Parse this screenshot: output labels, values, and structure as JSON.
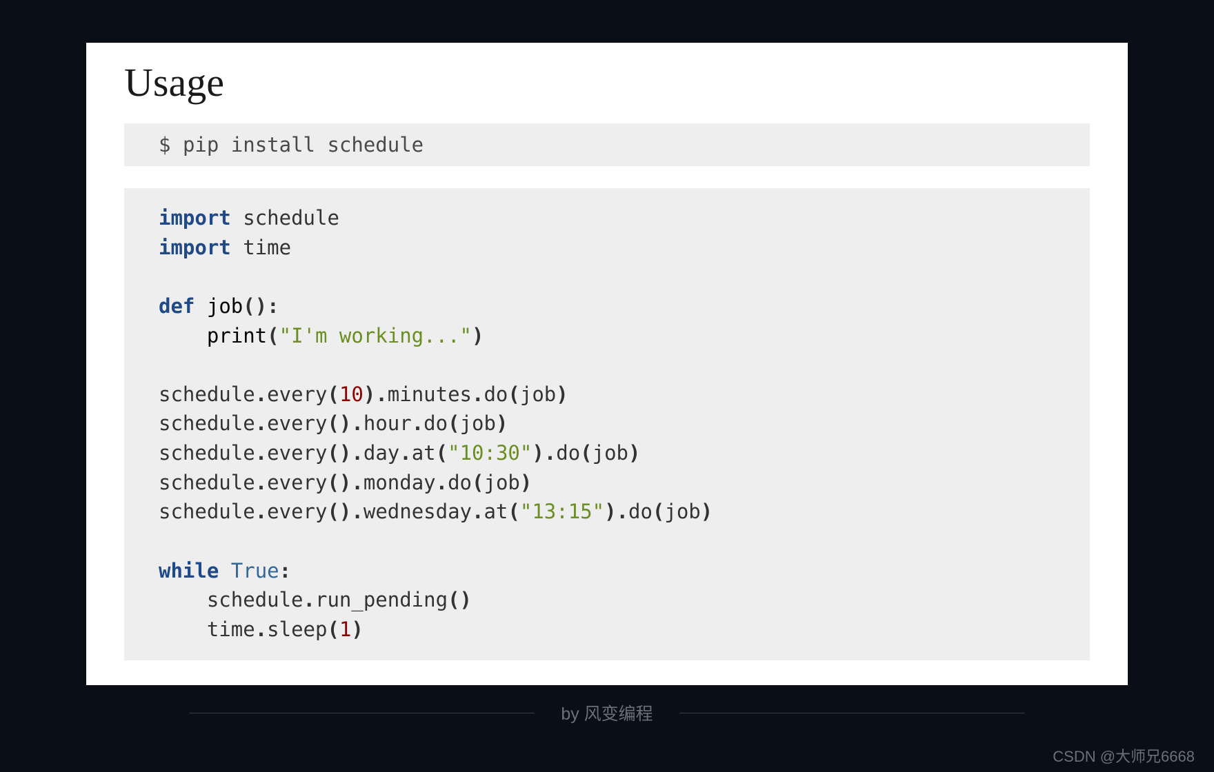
{
  "heading": "Usage",
  "shell": {
    "prompt": "$",
    "command": "pip install schedule"
  },
  "code": {
    "line1_kw": "import",
    "line1_mod": "schedule",
    "line2_kw": "import",
    "line2_mod": "time",
    "line4_kw": "def",
    "line4_name": "job",
    "line4_colon": ":",
    "line5_fn": "print",
    "line5_str": "\"I'm working...\"",
    "line7_call": "schedule",
    "line7_every": "every",
    "line7_num": "10",
    "line7_unit": "minutes",
    "line7_do": "do",
    "line7_job": "job",
    "line8_call": "schedule",
    "line8_every": "every",
    "line8_unit": "hour",
    "line8_do": "do",
    "line8_job": "job",
    "line9_call": "schedule",
    "line9_every": "every",
    "line9_unit": "day",
    "line9_at": "at",
    "line9_str": "\"10:30\"",
    "line9_do": "do",
    "line9_job": "job",
    "line10_call": "schedule",
    "line10_every": "every",
    "line10_unit": "monday",
    "line10_do": "do",
    "line10_job": "job",
    "line11_call": "schedule",
    "line11_every": "every",
    "line11_unit": "wednesday",
    "line11_at": "at",
    "line11_str": "\"13:15\"",
    "line11_do": "do",
    "line11_job": "job",
    "line13_kw": "while",
    "line13_true": "True",
    "line13_colon": ":",
    "line14_call": "schedule",
    "line14_fn": "run_pending",
    "line15_call": "time",
    "line15_fn": "sleep",
    "line15_num": "1"
  },
  "footer": "by 风变编程",
  "watermark": "CSDN @大师兄6668"
}
